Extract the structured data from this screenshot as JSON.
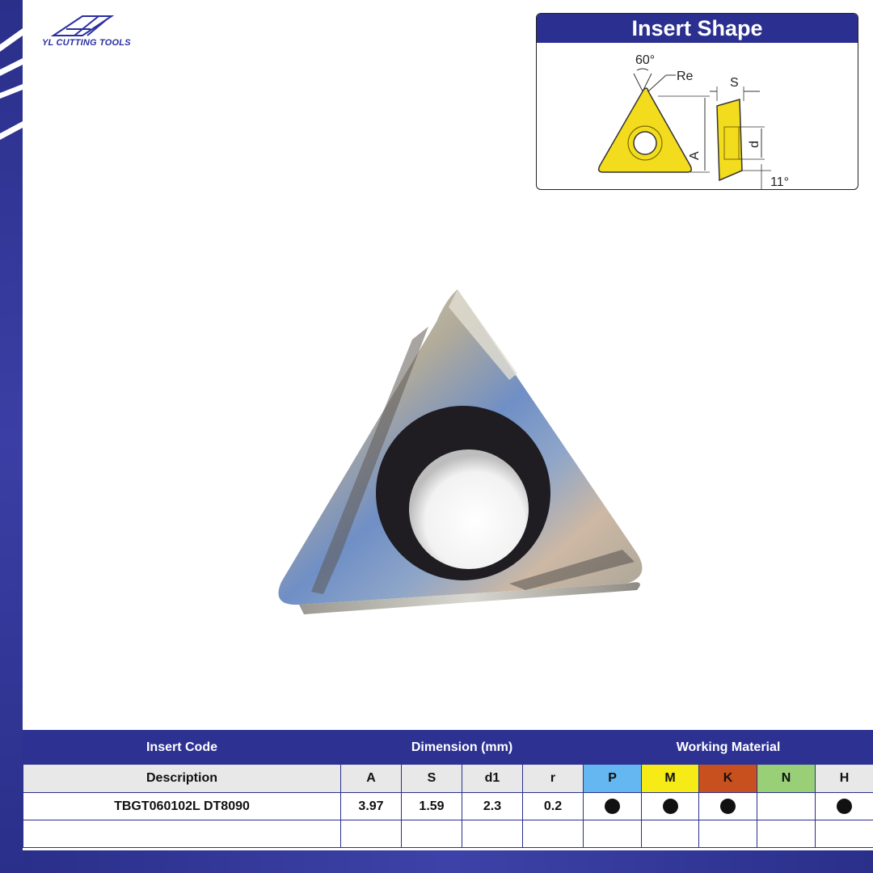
{
  "brand": {
    "name": "YL CUTTING TOOLS"
  },
  "insert_shape": {
    "title": "Insert Shape",
    "labels": {
      "angle": "60°",
      "radius": "Re",
      "thickness": "S",
      "inscribed": "A",
      "hole": "d",
      "clearance": "11°"
    },
    "colors": {
      "insert": "#f2dc1d",
      "header": "#2b2f8f"
    }
  },
  "table": {
    "groups": {
      "code": "Insert Code",
      "dimension": "Dimension (mm)",
      "material": "Working Material"
    },
    "columns": {
      "description": "Description",
      "a": "A",
      "s": "S",
      "d1": "d1",
      "r": "r"
    },
    "materials": [
      {
        "key": "P",
        "color": "#64b7f1"
      },
      {
        "key": "M",
        "color": "#f6ea17"
      },
      {
        "key": "K",
        "color": "#c8501f"
      },
      {
        "key": "N",
        "color": "#98cf77"
      },
      {
        "key": "H",
        "color": "#e8e8e8"
      }
    ],
    "rows": [
      {
        "description": "TBGT060102L DT8090",
        "a": "3.97",
        "s": "1.59",
        "d1": "2.3",
        "r": "0.2",
        "suitable": {
          "P": true,
          "M": true,
          "K": true,
          "N": false,
          "H": true
        }
      }
    ]
  }
}
